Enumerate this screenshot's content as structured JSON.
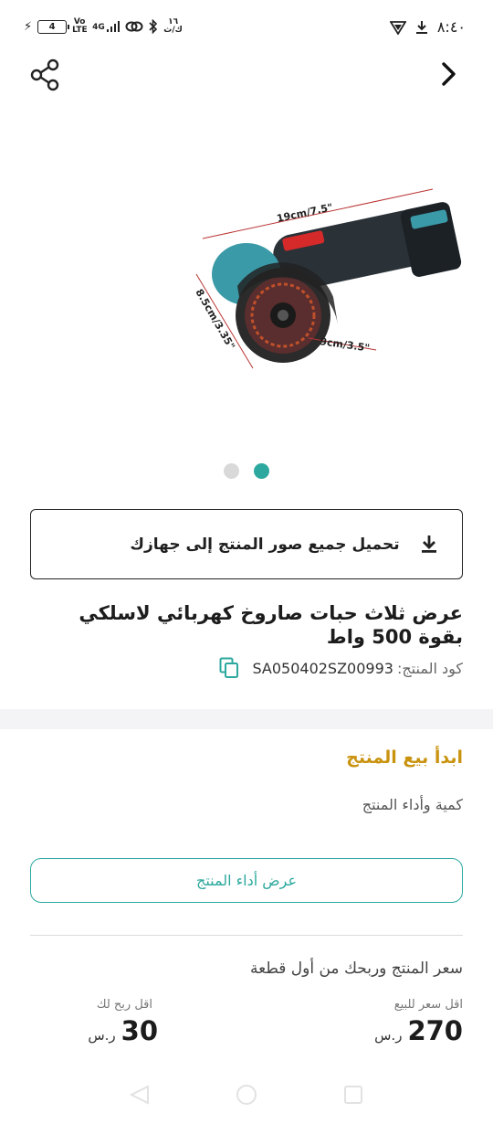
{
  "status_bar": {
    "time": "٨:٤٠",
    "battery_level": "4",
    "network_type": "4G",
    "volte": "Vo LTE",
    "data_speed_top": "١٦",
    "data_speed_bottom": "ك/ث"
  },
  "header": {
    "back_icon": "chevron-right-icon",
    "share_icon": "share-icon"
  },
  "gallery": {
    "total_images": 2,
    "active_index": 1,
    "dimension_length": "19cm/7.5\"",
    "dimension_height": "8.5cm/3.35\"",
    "dimension_disc": "9cm/3.5\""
  },
  "download": {
    "label": "تحميل جميع صور المنتج إلى جهازك",
    "icon": "download-icon"
  },
  "product": {
    "title": "عرض ثلاث حبات صاروخ كهربائي لاسلكي بقوة 500 واط",
    "code_label": "كود المنتج:",
    "code_value": "SA050402SZ00993"
  },
  "sell": {
    "heading": "ابدأ بيع المنتج",
    "subheading": "كمية وأداء المنتج",
    "performance_button": "عرض أداء المنتج"
  },
  "pricing": {
    "heading": "سعر المنتج وربحك من أول قطعة",
    "min_price_label": "اقل سعر للبيع",
    "min_price_value": "270",
    "min_profit_label": "اقل ربح لك",
    "min_profit_value": "30",
    "currency": "ر.س"
  },
  "colors": {
    "accent": "#2ca89e",
    "gold": "#c9930f",
    "text": "#1c1c1c"
  }
}
